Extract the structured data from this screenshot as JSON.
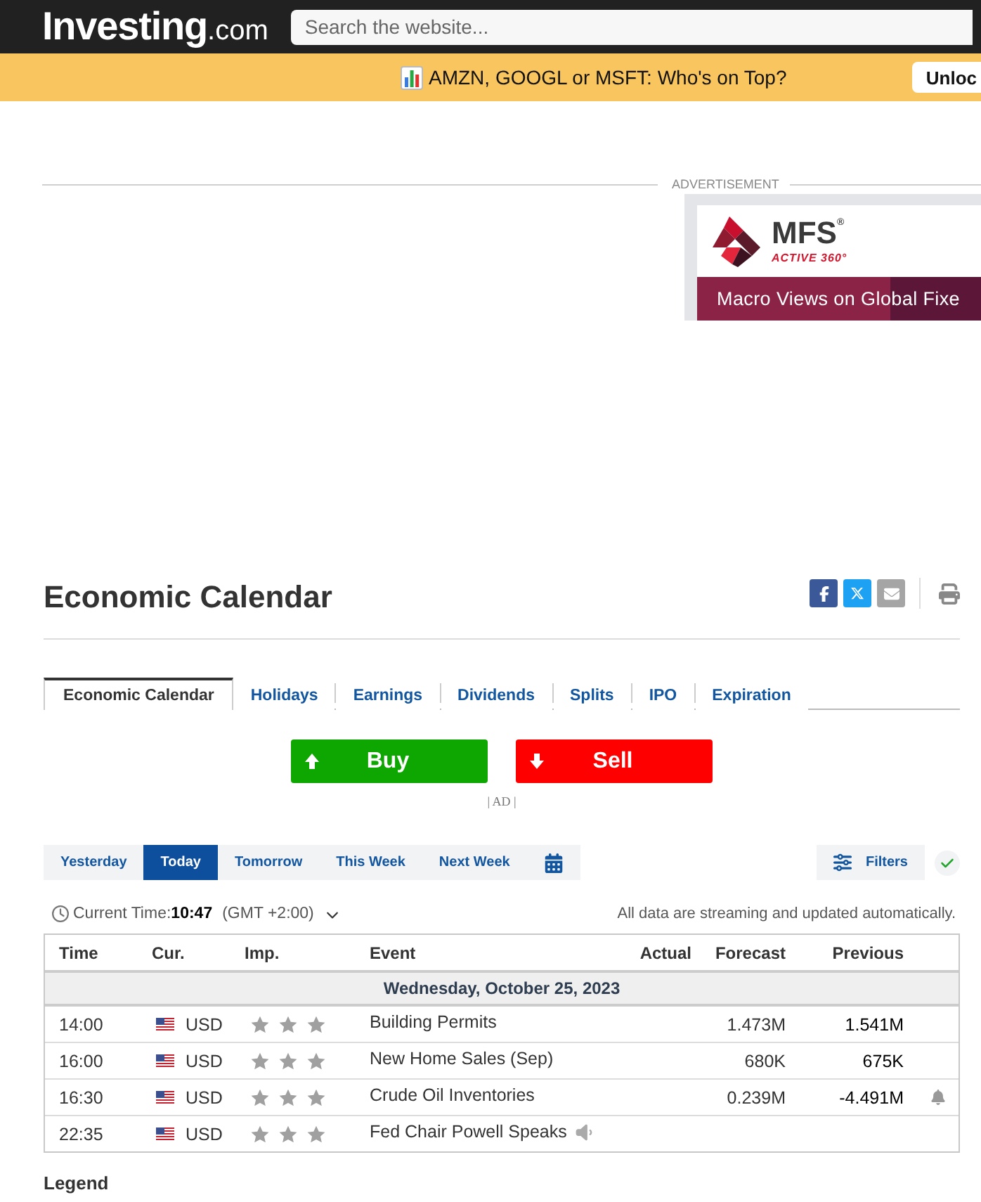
{
  "header": {
    "logo": {
      "name": "Investing",
      "suffix": ".com"
    },
    "search": {
      "placeholder": "Search the website..."
    }
  },
  "banner": {
    "text": "AMZN, GOOGL or MSFT: Who's on Top?",
    "button": "Unloc"
  },
  "advertisement": {
    "label": "ADVERTISEMENT",
    "brand": "MFS$^{®}$",
    "tagline": "ACTIVE 360°",
    "headline": "Macro Views on Global Fixe"
  },
  "page": {
    "title": "Economic Calendar"
  },
  "tabs": [
    {
      "label": "Economic Calendar",
      "selected": true
    },
    {
      "label": "Holidays",
      "selected": false
    },
    {
      "label": "Earnings",
      "selected": false
    },
    {
      "label": "Dividends",
      "selected": false
    },
    {
      "label": "Splits",
      "selected": false
    },
    {
      "label": "IPO",
      "selected": false
    },
    {
      "label": "Expiration",
      "selected": false
    }
  ],
  "trade_buttons": [
    {
      "kind": "buy",
      "label": "Buy"
    },
    {
      "kind": "sell",
      "label": "Sell"
    }
  ],
  "ad_marker": "| AD |",
  "period_tabs": [
    {
      "label": "Yesterday",
      "selected": false
    },
    {
      "label": "Today",
      "selected": true
    },
    {
      "label": "Tomorrow",
      "selected": false
    },
    {
      "label": "This Week",
      "selected": false
    },
    {
      "label": "Next Week",
      "selected": false
    }
  ],
  "filters": {
    "label": "Filters"
  },
  "time_bar": {
    "label": "Current Time:",
    "time": "10:47",
    "zone": "(GMT +2:00)",
    "note": "All data are streaming and updated automatically."
  },
  "table": {
    "columns": [
      "Time",
      "Cur.",
      "Imp.",
      "Event",
      "Actual",
      "Forecast",
      "Previous"
    ],
    "date": "Wednesday, October 25, 2023",
    "rows": [
      {
        "time": "14:00",
        "currency": "USD",
        "stars": 3,
        "event": "Building Permits",
        "forecast": "1.473M",
        "previous": "1.541M",
        "alert": false,
        "audio": false
      },
      {
        "time": "16:00",
        "currency": "USD",
        "stars": 3,
        "event": "New Home Sales (Sep)",
        "forecast": "680K",
        "previous": "675K",
        "alert": false,
        "audio": false
      },
      {
        "time": "16:30",
        "currency": "USD",
        "stars": 3,
        "event": "Crude Oil Inventories",
        "forecast": "0.239M",
        "previous": "-4.491M",
        "alert": true,
        "audio": false
      },
      {
        "time": "22:35",
        "currency": "USD",
        "stars": 3,
        "event": "Fed Chair Powell Speaks",
        "alert": false,
        "audio": true
      }
    ]
  },
  "legend": {
    "title": "Legend"
  }
}
